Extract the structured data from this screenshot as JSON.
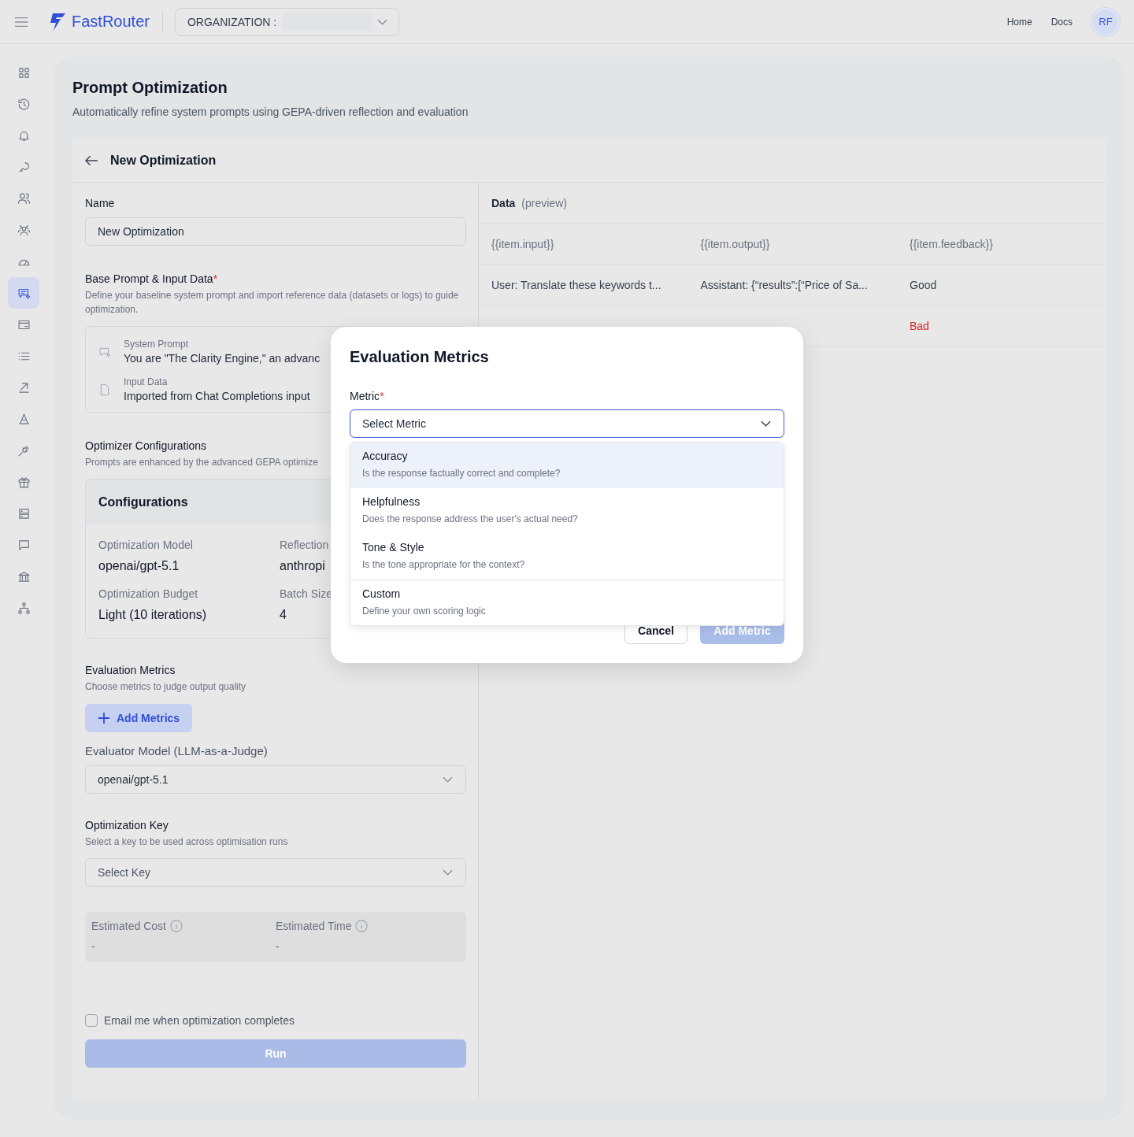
{
  "topbar": {
    "brand": "FastRouter",
    "org_label": "ORGANIZATION :",
    "links": [
      "Home",
      "Docs"
    ],
    "avatar": "RF"
  },
  "sidebar": {
    "items": [
      {
        "selected": false
      },
      {
        "selected": false
      },
      {
        "selected": false
      },
      {
        "selected": false
      },
      {
        "selected": false
      },
      {
        "selected": false
      },
      {
        "selected": false
      },
      {
        "selected": true
      },
      {
        "selected": false
      },
      {
        "selected": false
      },
      {
        "selected": false
      },
      {
        "selected": false
      },
      {
        "selected": false
      },
      {
        "selected": false
      },
      {
        "selected": false
      },
      {
        "selected": false
      },
      {
        "selected": false
      },
      {
        "selected": false
      }
    ]
  },
  "page": {
    "title": "Prompt Optimization",
    "subtitle": "Automatically refine system prompts using GEPA-driven reflection and evaluation"
  },
  "form": {
    "title": "New Optimization",
    "name": {
      "label": "Name",
      "value": "New Optimization"
    },
    "base": {
      "title": "Base Prompt & Input Data",
      "required_mark": "*",
      "description": "Define your baseline system prompt and import reference data (datasets or logs) to guide optimization.",
      "system_prompt": {
        "label": "System Prompt",
        "value": "You are \"The Clarity Engine,\" an advanc"
      },
      "input_data": {
        "label": "Input Data",
        "value": "Imported from Chat Completions input"
      }
    },
    "optimizer": {
      "title": "Optimizer Configurations",
      "description": "Prompts are enhanced by the advanced GEPA optimize",
      "card_title": "Configurations",
      "fields": [
        {
          "label": "Optimization Model",
          "value": "openai/gpt-5.1"
        },
        {
          "label": "Reflection",
          "value": "anthropi"
        },
        {
          "label": "Optimization Budget",
          "value": "Light (10 iterations)"
        },
        {
          "label": "Batch Size",
          "value": "4"
        }
      ]
    },
    "metrics": {
      "title": "Evaluation Metrics",
      "description": "Choose metrics to judge output quality",
      "add_button": "Add Metrics",
      "evaluator_label": "Evaluator Model (LLM-as-a-Judge)",
      "evaluator_value": "openai/gpt-5.1"
    },
    "key": {
      "title": "Optimization Key",
      "description": "Select a key to be used across optimisation runs",
      "placeholder": "Select Key"
    },
    "estimates": [
      {
        "label": "Estimated Cost",
        "value": "-"
      },
      {
        "label": "Estimated Time",
        "value": "-"
      }
    ],
    "email": {
      "label": "Email me when optimization completes",
      "checked": false
    },
    "run_button": {
      "label": "Run",
      "disabled": true
    }
  },
  "data_preview": {
    "title": "**Data** (preview)",
    "columns": [
      "{{item.input}}",
      "{{item.output}}",
      "{{item.feedback}}"
    ],
    "rows": [
      {
        "input": "User: Translate these keywords t...",
        "output": "Assistant: {“results”:[“Price of Sa...",
        "feedback": "Good",
        "color": "#374151"
      },
      {
        "feedback": "Bad",
        "color": "#dc2626"
      }
    ]
  },
  "modal": {
    "title": "Evaluation Metrics",
    "field_label": "Metric",
    "required_mark": "*",
    "placeholder": "Select Metric",
    "options": [
      {
        "kind": "preset",
        "title": "Accuracy",
        "description": "Is the response factually correct and complete?",
        "highlighted": true
      },
      {
        "kind": "preset",
        "title": "Helpfulness",
        "description": "Does the response address the user's actual need?",
        "highlighted": false
      },
      {
        "kind": "preset",
        "title": "Tone & Style",
        "description": "Is the tone appropriate for the context?",
        "highlighted": false
      },
      {
        "kind": "custom",
        "title": "Custom",
        "description": "Define your own scoring logic",
        "highlighted": false
      }
    ],
    "cancel": "Cancel",
    "confirm": {
      "label": "Add Metric",
      "disabled": true
    }
  }
}
